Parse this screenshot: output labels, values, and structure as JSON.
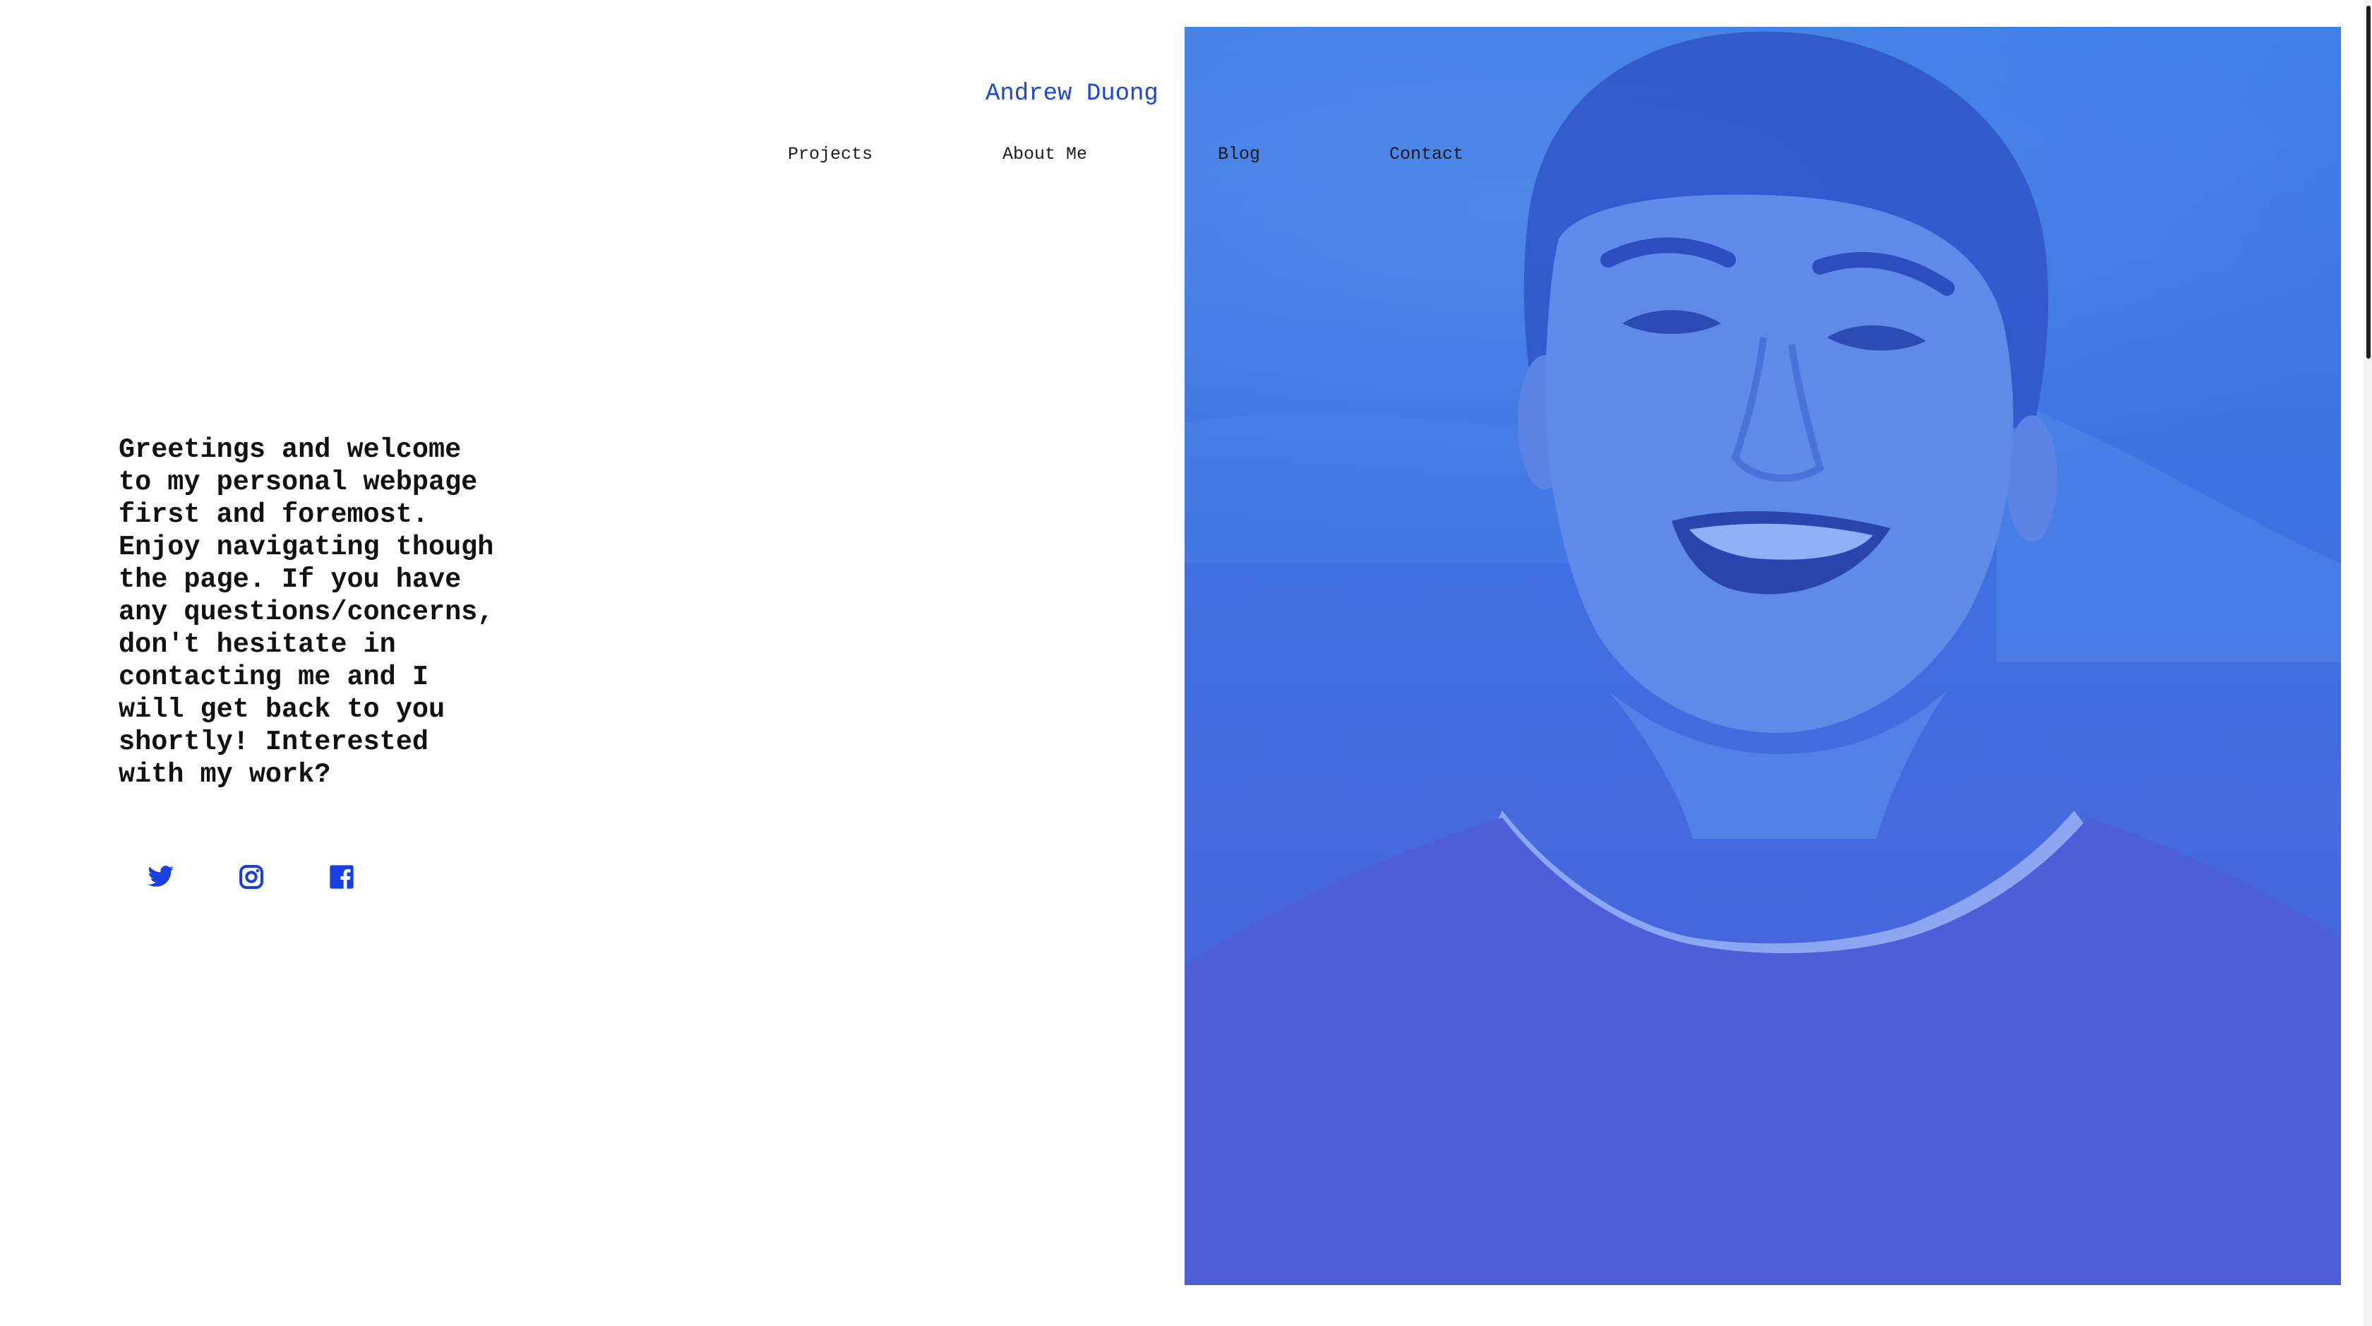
{
  "header": {
    "brand": "Andrew Duong",
    "nav": [
      {
        "label": "Projects"
      },
      {
        "label": "About Me"
      },
      {
        "label": "Blog"
      },
      {
        "label": "Contact"
      }
    ]
  },
  "intro": {
    "text": "Greetings and welcome\nto my personal webpage\nfirst and foremost.\nEnjoy navigating though\nthe page. If you have\nany questions/concerns,\ndon't hesitate in\ncontacting me and I\nwill get back to you\nshortly! Interested\nwith my work?"
  },
  "social": [
    {
      "icon": "twitter-icon"
    },
    {
      "icon": "instagram-icon"
    },
    {
      "icon": "facebook-icon"
    }
  ],
  "hero": {
    "image": "portrait-photo"
  },
  "colors": {
    "accent": "#1a45e6",
    "hero_tint": "#3f6fe0",
    "text": "#111111"
  }
}
